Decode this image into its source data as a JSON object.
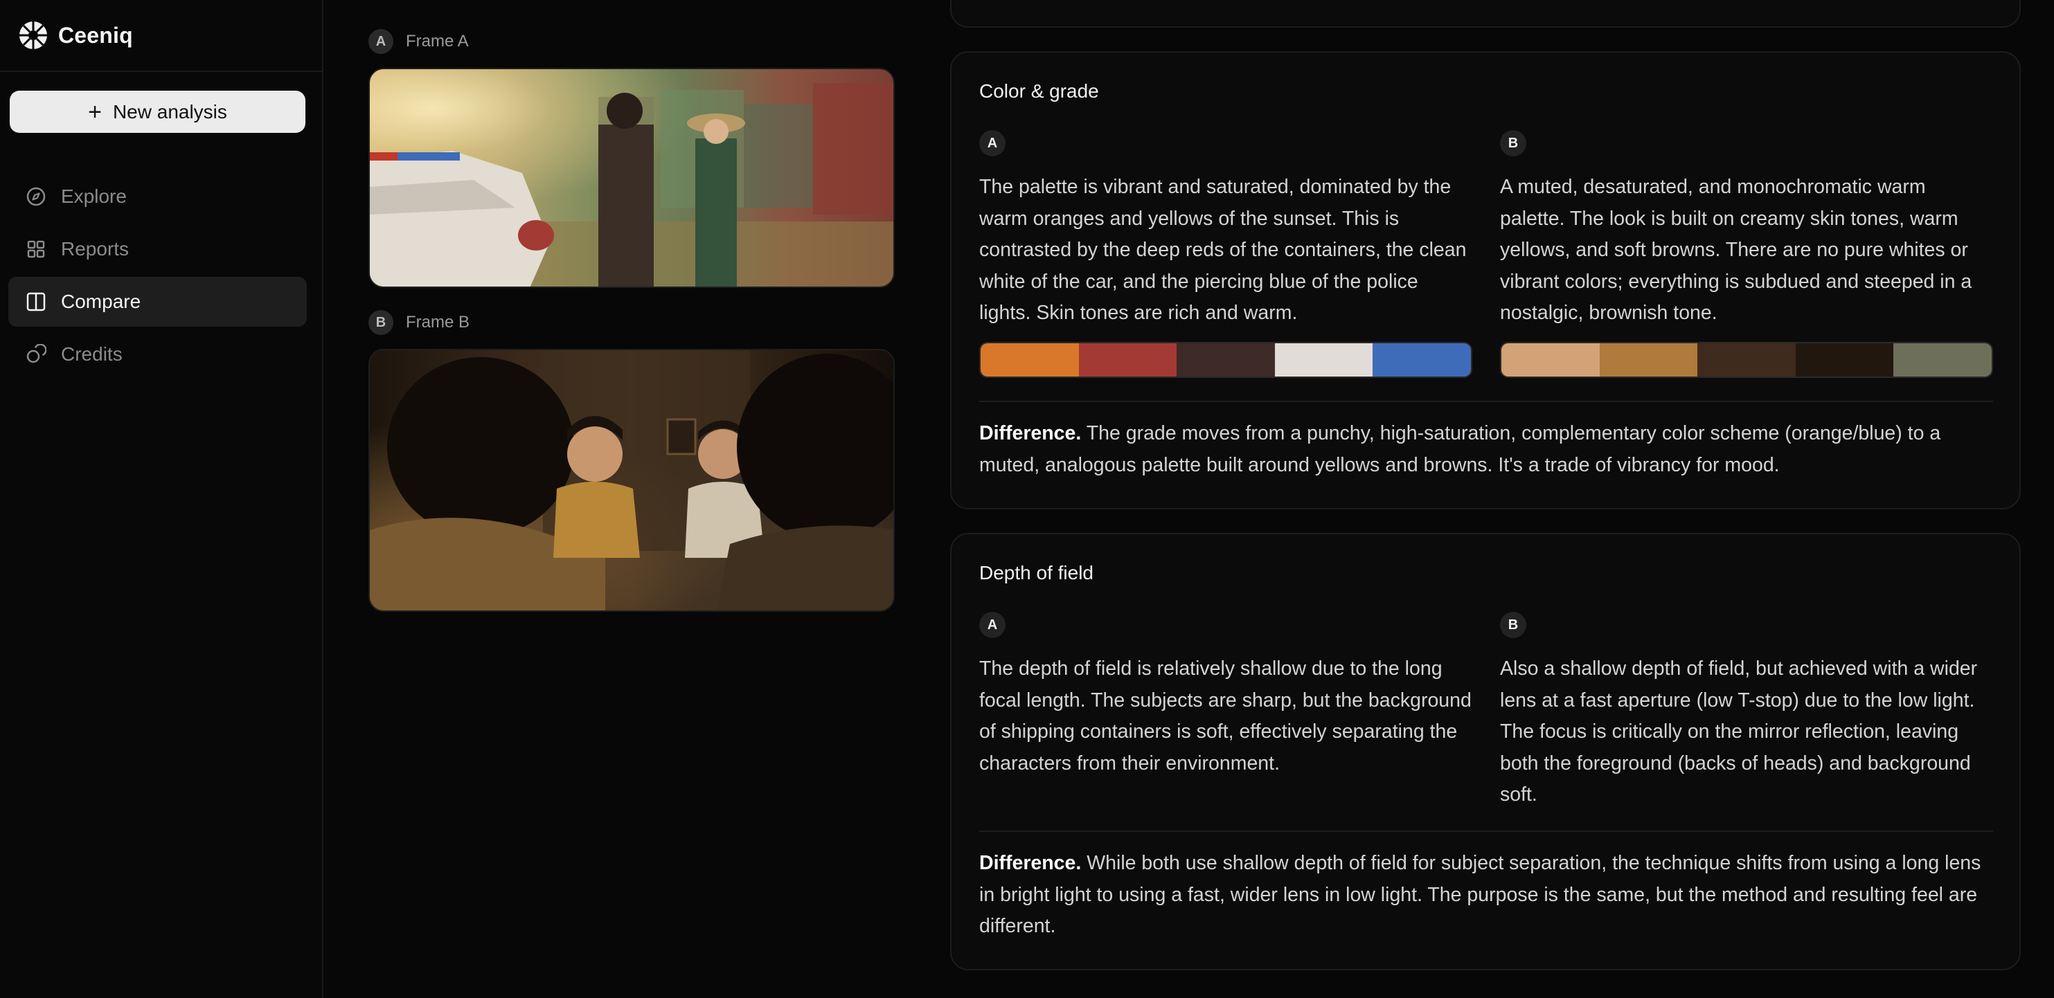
{
  "app": {
    "name": "Ceeniq",
    "logo_icon": "aperture-icon"
  },
  "sidebar": {
    "new_button": "New analysis",
    "items": [
      {
        "label": "Explore",
        "icon": "compass-icon",
        "active": false
      },
      {
        "label": "Reports",
        "icon": "grid-icon",
        "active": false
      },
      {
        "label": "Compare",
        "icon": "columns-icon",
        "active": true
      },
      {
        "label": "Credits",
        "icon": "coins-icon",
        "active": false
      }
    ]
  },
  "frames": {
    "a": {
      "badge": "A",
      "label": "Frame A"
    },
    "b": {
      "badge": "B",
      "label": "Frame B"
    }
  },
  "color_grade": {
    "title": "Color & grade",
    "a": {
      "badge": "A",
      "text": "The palette is vibrant and saturated, dominated by the warm oranges and yellows of the sunset. This is contrasted by the deep reds of the containers, the clean white of the car, and the piercing blue of the police lights. Skin tones are rich and warm.",
      "swatches": [
        "#d9782a",
        "#a33a34",
        "#3e2a27",
        "#e2dcd9",
        "#3f6cb9"
      ]
    },
    "b": {
      "badge": "B",
      "text": "A muted, desaturated, and monochromatic warm palette. The look is built on creamy skin tones, warm yellows, and soft browns. There are no pure whites or vibrant colors; everything is subdued and steeped in a nostalgic, brownish tone.",
      "swatches": [
        "#d3a276",
        "#b07a3c",
        "#3f2b1d",
        "#22170f",
        "#6d6f5a"
      ]
    },
    "difference_label": "Difference.",
    "difference_text": " The grade moves from a punchy, high-saturation, complementary color scheme (orange/blue) to a muted, analogous palette built around yellows and browns. It's a trade of vibrancy for mood."
  },
  "depth_of_field": {
    "title": "Depth of field",
    "a": {
      "badge": "A",
      "text": "The depth of field is relatively shallow due to the long focal length. The subjects are sharp, but the background of shipping containers is soft, effectively separating the characters from their environment."
    },
    "b": {
      "badge": "B",
      "text": "Also a shallow depth of field, but achieved with a wider lens at a fast aperture (low T-stop) due to the low light. The focus is critically on the mirror reflection, leaving both the foreground (backs of heads) and background soft."
    },
    "difference_label": "Difference.",
    "difference_text": " While both use shallow depth of field for subject separation, the technique shifts from using a long lens in bright light to using a fast, wider lens in low light. The purpose is the same, but the method and resulting feel are different."
  }
}
